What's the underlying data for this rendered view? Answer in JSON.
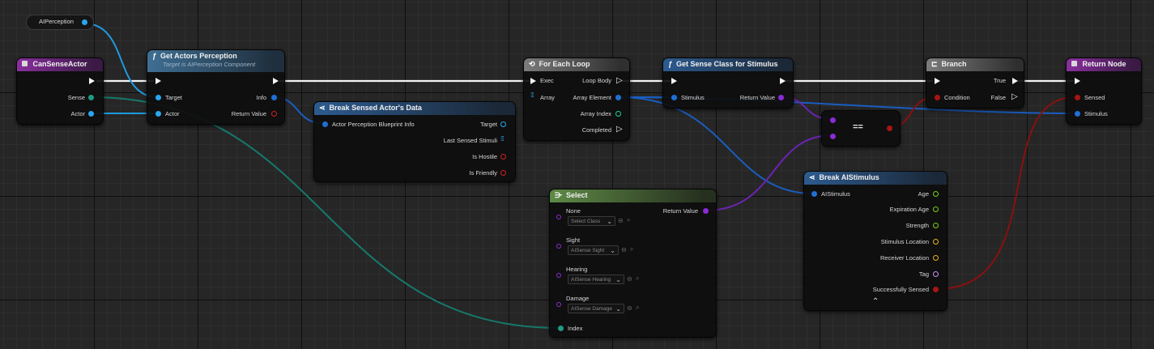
{
  "nodes": {
    "ai_perception": {
      "label": "AIPerception"
    },
    "can_sense_actor": {
      "title": "CanSenseActor",
      "pins": {
        "sense": "Sense",
        "actor": "Actor"
      }
    },
    "get_actors_perception": {
      "title": "Get Actors Perception",
      "subtitle": "Target is AIPerception Component",
      "pins": {
        "target": "Target",
        "actor": "Actor",
        "info": "Info",
        "return_value": "Return Value"
      }
    },
    "break_sensed": {
      "title": "Break Sensed Actor's Data",
      "pins": {
        "input": "Actor Perception Blueprint Info",
        "target": "Target",
        "last_sensed": "Last Sensed Stimuli",
        "is_hostile": "Is Hostile",
        "is_friendly": "Is Friendly"
      }
    },
    "for_each": {
      "title": "For Each Loop",
      "pins": {
        "exec": "Exec",
        "array": "Array",
        "loop_body": "Loop Body",
        "array_element": "Array Element",
        "array_index": "Array Index",
        "completed": "Completed"
      }
    },
    "get_sense_class": {
      "title": "Get Sense Class for Stimulus",
      "pins": {
        "stimulus": "Stimulus",
        "return_value": "Return Value"
      }
    },
    "branch": {
      "title": "Branch",
      "pins": {
        "condition": "Condition",
        "true": "True",
        "false": "False"
      }
    },
    "return_node": {
      "title": "Return Node",
      "pins": {
        "sensed": "Sensed",
        "stimulus": "Stimulus"
      }
    },
    "equals": {
      "label": "=="
    },
    "select": {
      "title": "Select",
      "return_value": "Return Value",
      "options": [
        {
          "label": "None",
          "value": "Select Class"
        },
        {
          "label": "Sight",
          "value": "AISense Sight"
        },
        {
          "label": "Hearing",
          "value": "AISense Hearing"
        },
        {
          "label": "Damage",
          "value": "AISense Damage"
        }
      ],
      "index": "Index"
    },
    "break_stimulus": {
      "title": "Break AIStimulus",
      "pins": {
        "input": "AIStimulus",
        "age": "Age",
        "expiration_age": "Expiration Age",
        "strength": "Strength",
        "stimulus_location": "Stimulus Location",
        "receiver_location": "Receiver Location",
        "tag": "Tag",
        "successfully_sensed": "Successfully Sensed"
      }
    }
  },
  "icons": {
    "function": "italic-f",
    "event": "purple-square",
    "loop": "loop-arrows",
    "break": "split-arrows",
    "branch": "branch-fork",
    "select": "select-arrows",
    "collapse": "chevron-up"
  },
  "colors": {
    "exec": "#f4f4f4",
    "object": "#2aa7f0",
    "struct": "#1f6fd6",
    "bool": "#a81515",
    "int": "#1e9a85",
    "class": "#8a2bd6",
    "float": "#78d020",
    "vector": "#e8b020",
    "name": "#c890f0"
  }
}
